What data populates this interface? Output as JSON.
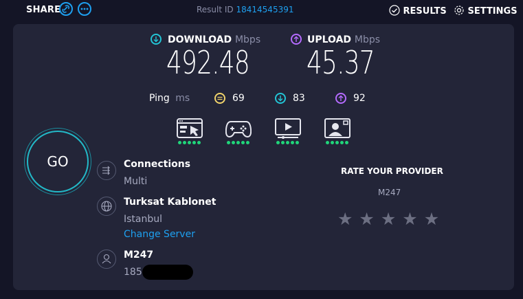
{
  "topbar": {
    "share_label": "SHARE",
    "result_id_label": "Result ID",
    "result_id_value": "18414545391",
    "results_label": "RESULTS",
    "settings_label": "SETTINGS"
  },
  "speed": {
    "download_label": "DOWNLOAD",
    "download_unit": "Mbps",
    "download_value": "492.48",
    "upload_label": "UPLOAD",
    "upload_unit": "Mbps",
    "upload_value": "45.37"
  },
  "ping": {
    "label": "Ping",
    "unit": "ms",
    "idle": "69",
    "download": "83",
    "upload": "92"
  },
  "activities": [
    {
      "icon": "browsing-icon",
      "rating": 5
    },
    {
      "icon": "gaming-icon",
      "rating": 5
    },
    {
      "icon": "streaming-icon",
      "rating": 5
    },
    {
      "icon": "video-call-icon",
      "rating": 5
    }
  ],
  "go_label": "GO",
  "connections": {
    "title": "Connections",
    "value": "Multi"
  },
  "server": {
    "title": "Turksat Kablonet",
    "location": "Istanbul",
    "change_label": "Change Server"
  },
  "user": {
    "title": "M247",
    "ip": "185."
  },
  "rating": {
    "heading": "RATE YOUR PROVIDER",
    "provider": "M247",
    "stars": 5
  },
  "colors": {
    "accent": "#1ea0f0",
    "download": "#23c5d6",
    "upload": "#b56bff",
    "ping_idle": "#f2d46b",
    "good": "#20d67a"
  }
}
